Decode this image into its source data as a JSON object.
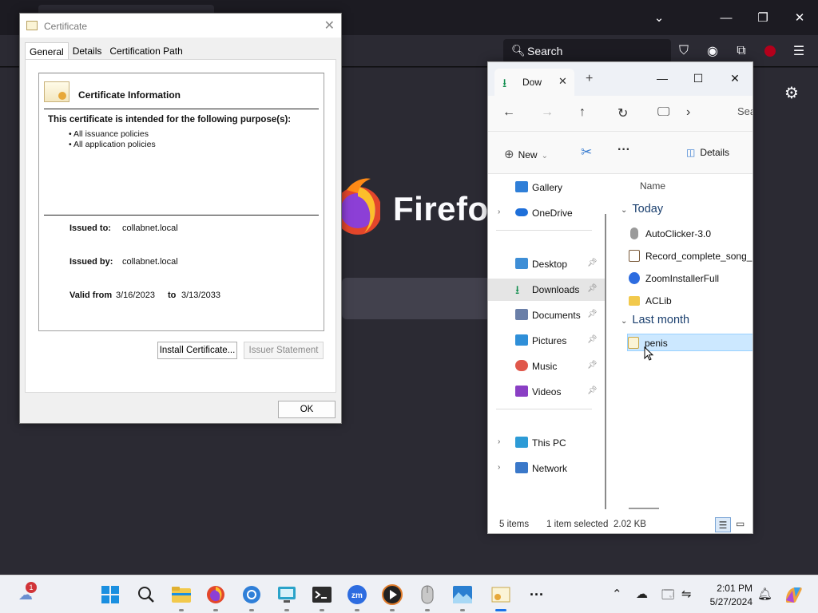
{
  "firefox": {
    "search_placeholder": "Search",
    "brand": "Firefox",
    "colors": {
      "bg": "#1c1b22",
      "toolbar": "#2b2a33",
      "content": "#2b2a33"
    }
  },
  "certificate_dialog": {
    "title": "Certificate",
    "close_glyph": "✕",
    "tabs": [
      "General",
      "Details",
      "Certification Path"
    ],
    "active_tab": "General",
    "info_title": "Certificate Information",
    "purpose_heading": "This certificate is intended for the following purpose(s):",
    "purposes": [
      "• All issuance policies",
      "• All application policies"
    ],
    "issued_to_label": "Issued to:",
    "issued_to": "collabnet.local",
    "issued_by_label": "Issued by:",
    "issued_by": "collabnet.local",
    "valid_from_label": "Valid from",
    "valid_from": "3/16/2023",
    "valid_to_label": "to",
    "valid_to": "3/13/2033",
    "install_button": "Install Certificate...",
    "issuer_statement_button": "Issuer Statement",
    "ok_button": "OK"
  },
  "explorer": {
    "tab_label": "Dow",
    "tab_close": "✕",
    "new_tab": "+",
    "address_hint": "Sea",
    "new_label": "New",
    "details_label": "Details",
    "nav_items": [
      {
        "label": "Gallery",
        "pinned": false,
        "expandable": false,
        "icon_color": "#2f7fd8"
      },
      {
        "label": "OneDrive",
        "pinned": false,
        "expandable": true,
        "icon_color": "#1e6fd9"
      },
      {
        "label": "Desktop",
        "pinned": true,
        "expandable": false,
        "icon_color": "#3e8ed6"
      },
      {
        "label": "Downloads",
        "pinned": true,
        "expandable": false,
        "selected": true,
        "icon_color": "#0f8d4d"
      },
      {
        "label": "Documents",
        "pinned": true,
        "expandable": false,
        "icon_color": "#6a7fa8"
      },
      {
        "label": "Pictures",
        "pinned": true,
        "expandable": false,
        "icon_color": "#2f8fd8"
      },
      {
        "label": "Music",
        "pinned": true,
        "expandable": false,
        "icon_color": "#e0574b"
      },
      {
        "label": "Videos",
        "pinned": true,
        "expandable": false,
        "icon_color": "#8a3fc4"
      },
      {
        "label": "This PC",
        "pinned": false,
        "expandable": true,
        "icon_color": "#2d9bd6"
      },
      {
        "label": "Network",
        "pinned": false,
        "expandable": true,
        "icon_color": "#3a78c9"
      }
    ],
    "column_name": "Name",
    "groups": [
      {
        "label": "Today",
        "files": [
          {
            "name": "AutoClicker-3.0",
            "icon_color": "#9a9a9a"
          },
          {
            "name": "Record_complete_song_@",
            "icon_color": "#7a5a3a"
          },
          {
            "name": "ZoomInstallerFull",
            "icon_color": "#2d6ce0"
          },
          {
            "name": "ACLib",
            "icon_color": "#f2c94c"
          }
        ]
      },
      {
        "label": "Last month",
        "files": [
          {
            "name": "penis",
            "icon_color": "#e7c46a",
            "selected": true
          }
        ]
      }
    ],
    "status_items": "5 items",
    "status_selected": "1 item selected",
    "status_size": "2.02 KB"
  },
  "taskbar": {
    "weather_badge": "1",
    "time": "2:01 PM",
    "date": "5/27/2024"
  }
}
